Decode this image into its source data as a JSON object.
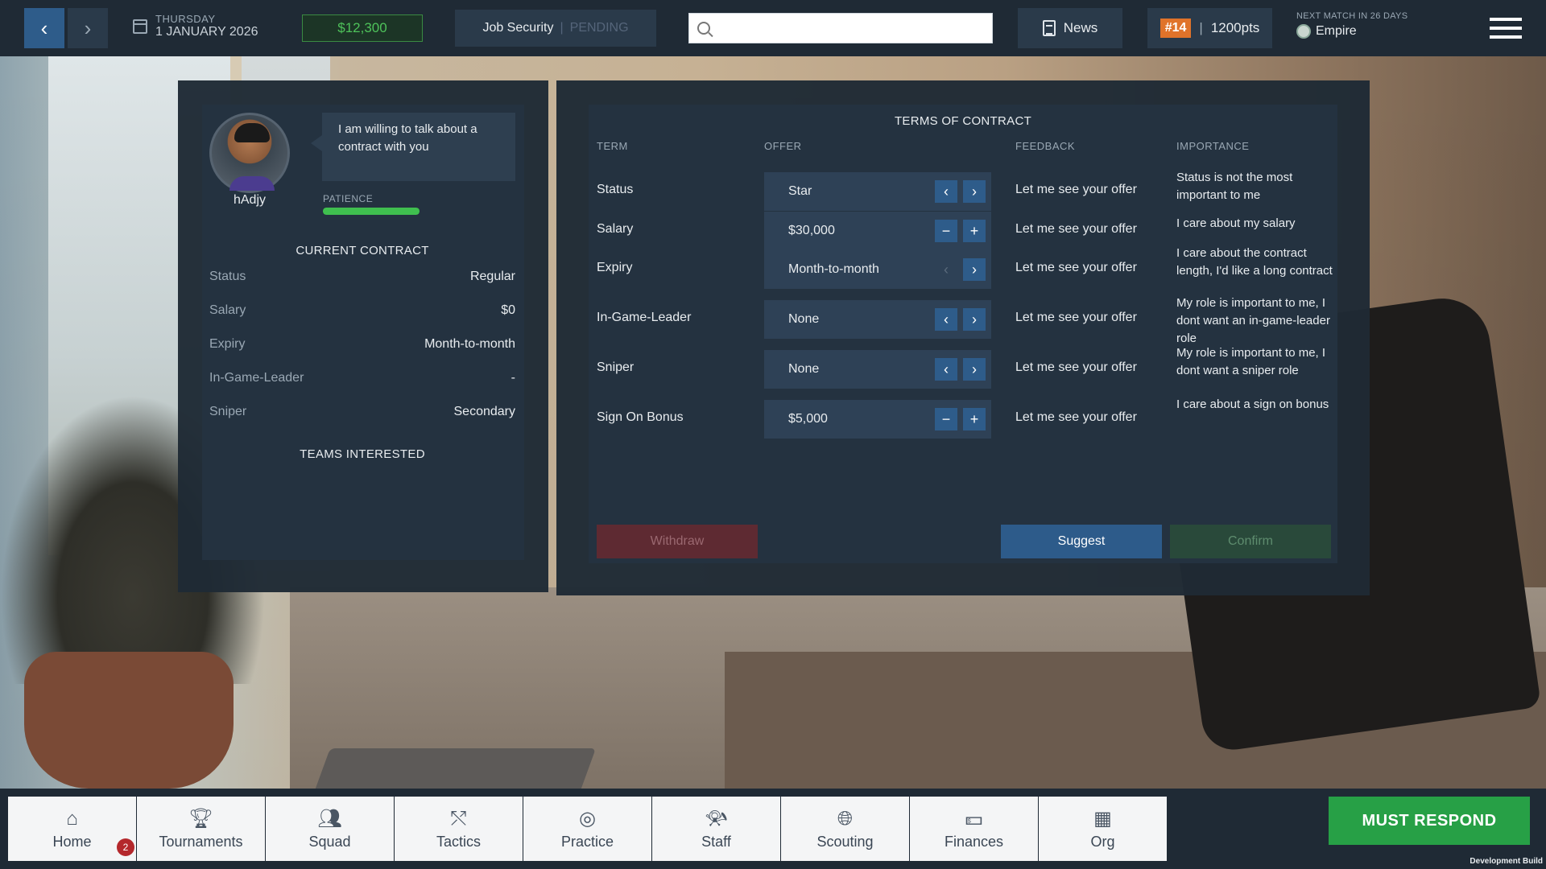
{
  "topbar": {
    "day": "THURSDAY",
    "date": "1 JANUARY 2026",
    "money": "$12,300",
    "job_security_label": "Job Security",
    "job_security_separator": "|",
    "job_security_status": "PENDING",
    "search_value": "",
    "news_label": "News",
    "rank_badge": "#14",
    "rank_separator": "|",
    "points": "1200pts",
    "next_match_label": "NEXT MATCH IN 26 DAYS",
    "next_match_team": "Empire",
    "colors": {
      "accent": "#2e5c8a",
      "money": "#4ec25a",
      "rank": "#e0732a"
    }
  },
  "player": {
    "name": "hAdjy",
    "speech": "I am willing to talk about a contract with you",
    "patience_label": "PATIENCE",
    "patience_value": 1.0,
    "current_contract_title": "CURRENT CONTRACT",
    "current_contract": [
      {
        "key": "Status",
        "value": "Regular"
      },
      {
        "key": "Salary",
        "value": "$0"
      },
      {
        "key": "Expiry",
        "value": "Month-to-month"
      },
      {
        "key": "In-Game-Leader",
        "value": "-"
      },
      {
        "key": "Sniper",
        "value": "Secondary"
      }
    ],
    "teams_interested_title": "TEAMS INTERESTED"
  },
  "terms": {
    "title": "TERMS OF CONTRACT",
    "headers": {
      "term": "TERM",
      "offer": "OFFER",
      "feedback": "FEEDBACK",
      "importance": "IMPORTANCE"
    },
    "rows": [
      {
        "term": "Status",
        "offer": "Star",
        "feedback": "Let me see your offer",
        "importance": "Status is not the most important to me",
        "control": "arrows"
      },
      {
        "term": "Salary",
        "offer": "$30,000",
        "feedback": "Let me see your offer",
        "importance": "I care about my salary",
        "control": "plusminus"
      },
      {
        "term": "Expiry",
        "offer": "Month-to-month",
        "feedback": "Let me see your offer",
        "importance": "I care about the contract length, I'd like a long contract",
        "control": "arrows-left-disabled"
      },
      {
        "term": "In-Game-Leader",
        "offer": "None",
        "feedback": "Let me see your offer",
        "importance": "My role is important to me, I dont want an in-game-leader role",
        "control": "arrows"
      },
      {
        "term": "Sniper",
        "offer": "None",
        "feedback": "Let me see your offer",
        "importance": "My role is important to me, I dont want a sniper role",
        "control": "arrows"
      },
      {
        "term": "Sign On Bonus",
        "offer": "$5,000",
        "feedback": "Let me see your offer",
        "importance": "I care about a sign on bonus",
        "control": "plusminus"
      }
    ],
    "buttons": {
      "withdraw": "Withdraw",
      "suggest": "Suggest",
      "confirm": "Confirm"
    }
  },
  "bottom_nav": {
    "items": [
      {
        "label": "Home",
        "icon": "home-icon"
      },
      {
        "label": "Tournaments",
        "icon": "trophy-icon"
      },
      {
        "label": "Squad",
        "icon": "users-icon"
      },
      {
        "label": "Tactics",
        "icon": "tactics-icon"
      },
      {
        "label": "Practice",
        "icon": "target-icon"
      },
      {
        "label": "Staff",
        "icon": "whistle-icon"
      },
      {
        "label": "Scouting",
        "icon": "globe-search-icon"
      },
      {
        "label": "Finances",
        "icon": "money-icon"
      },
      {
        "label": "Org",
        "icon": "building-icon"
      }
    ],
    "home_notification": "2",
    "must_respond": "MUST RESPOND"
  },
  "footer": {
    "build": "Development Build"
  }
}
